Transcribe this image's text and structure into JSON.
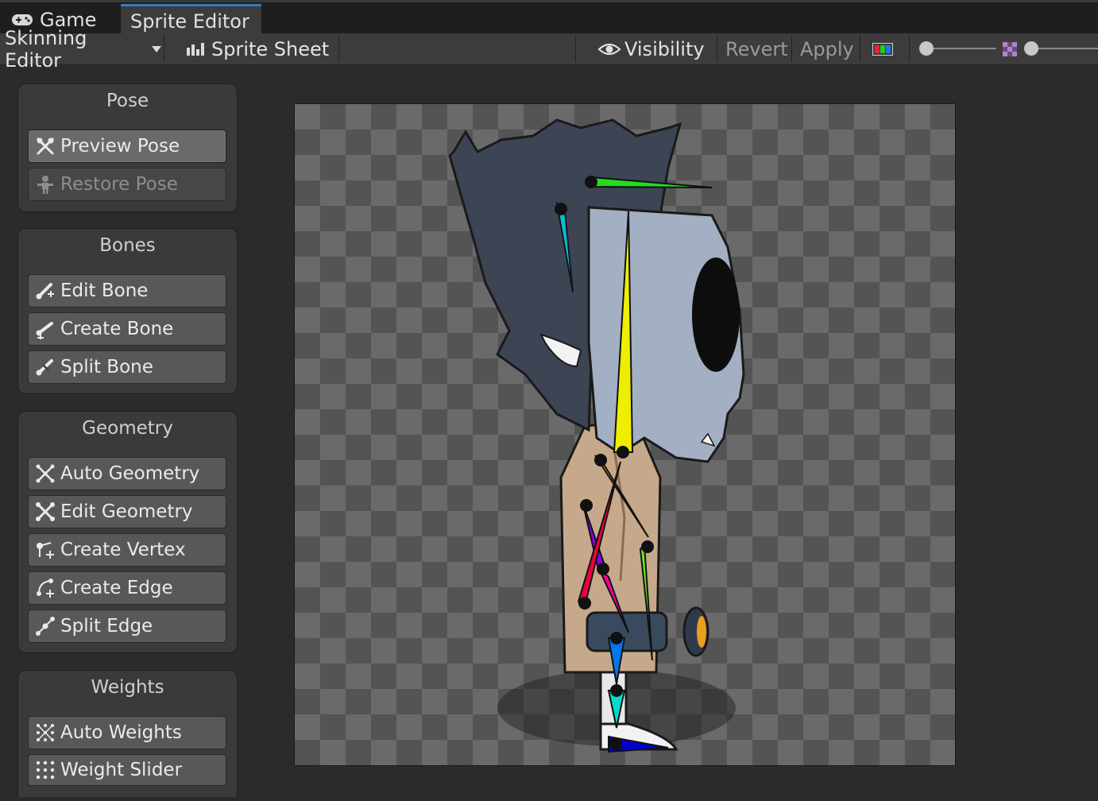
{
  "tabs": [
    {
      "label": "Game",
      "icon": "gamepad-icon"
    },
    {
      "label": "Sprite Editor"
    }
  ],
  "toolbar": {
    "mode_label": "Skinning Editor",
    "sprite_sheet_label": "Sprite Sheet",
    "visibility_label": "Visibility",
    "revert_label": "Revert",
    "apply_label": "Apply"
  },
  "panels": {
    "pose": {
      "title": "Pose",
      "buttons": [
        "Preview Pose",
        "Restore Pose"
      ]
    },
    "bones": {
      "title": "Bones",
      "buttons": [
        "Edit Bone",
        "Create Bone",
        "Split Bone"
      ]
    },
    "geometry": {
      "title": "Geometry",
      "buttons": [
        "Auto Geometry",
        "Edit Geometry",
        "Create Vertex",
        "Create Edge",
        "Split Edge"
      ]
    },
    "weights": {
      "title": "Weights",
      "buttons": [
        "Auto Weights",
        "Weight Slider"
      ]
    }
  },
  "colors": {
    "tab_active_accent": "#3a79bb",
    "panel_bg": "#3a3a3a",
    "button_bg": "#585858",
    "bone_colors": [
      "#22dd22",
      "#00ccdd",
      "#eeee00",
      "#ff7f00",
      "#8800ee",
      "#ee0044",
      "#ff0099",
      "#66ee11",
      "#0077ee",
      "#00ddcc",
      "#0000cc"
    ]
  }
}
